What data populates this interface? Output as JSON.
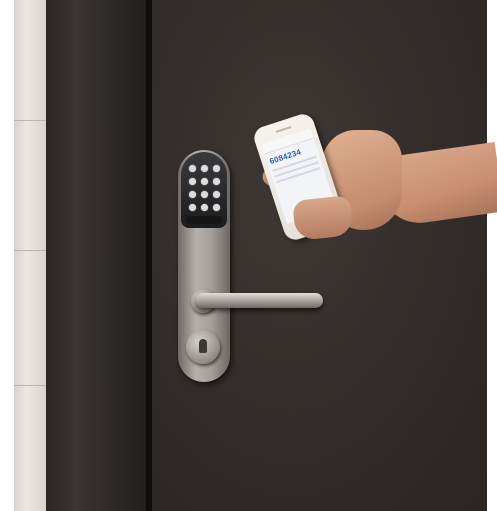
{
  "scene": {
    "description_free": true
  },
  "phone_screen": {
    "code_text": "6084234"
  },
  "colors": {
    "door": "#332e2b",
    "keypad": "#1c1c1e",
    "steel": "#b5b0ab",
    "skin": "#c98f70",
    "screen_accent": "#2f5fa8"
  },
  "icons": [
    "keypad-icon",
    "lever-handle-icon",
    "key-cylinder-icon",
    "smartphone-icon"
  ]
}
